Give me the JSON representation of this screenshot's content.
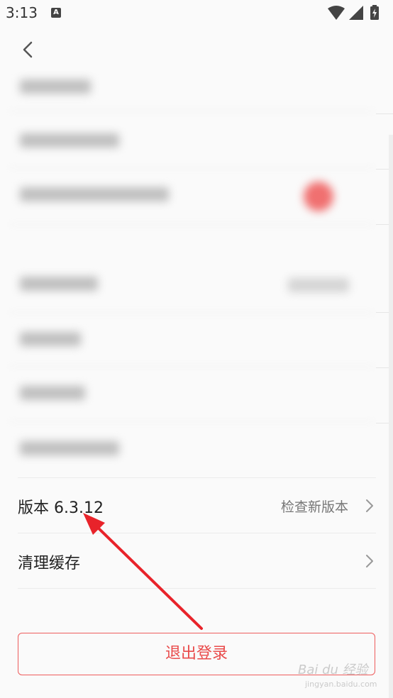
{
  "status_bar": {
    "time": "3:13",
    "notification_icon": "A"
  },
  "settings": {
    "version_label": "版本 6.3.12",
    "check_update_label": "检查新版本",
    "clear_cache_label": "清理缓存"
  },
  "logout_label": "退出登录",
  "watermark": {
    "brand": "Bai du 经验",
    "site": "jingyan.baidu.com"
  },
  "colors": {
    "accent": "#e94a4a",
    "annotation_arrow": "#e8232a"
  },
  "icons": [
    "wifi-icon",
    "signal-icon",
    "battery-charging-icon",
    "back-chevron-icon",
    "chevron-right-icon"
  ]
}
